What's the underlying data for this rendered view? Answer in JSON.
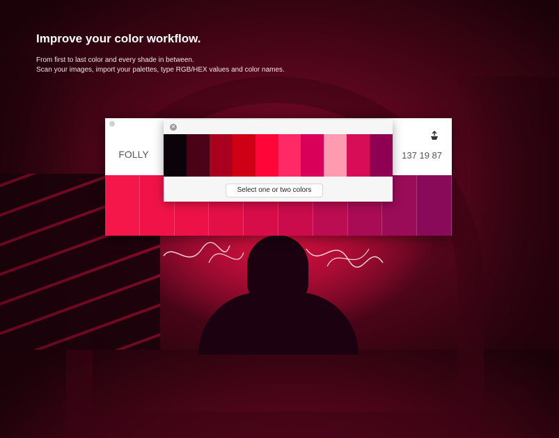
{
  "hero": {
    "title": "Improve your color workflow.",
    "line1": "From first to last color and every shade in between.",
    "line2": "Scan your images, import your palettes, type RGB/HEX values and color names."
  },
  "app": {
    "color_name": "FOLLY",
    "rgb": "137 19 87",
    "export_icon": "export-icon",
    "shades": [
      "#f5174a",
      "#f11348",
      "#ec1247",
      "#e21047",
      "#d70d4a",
      "#cb0c4c",
      "#bb0d51",
      "#a90c55",
      "#9a0c58",
      "#8a0a5a"
    ]
  },
  "picker": {
    "swatches": [
      "#0b0309",
      "#4a0216",
      "#a8001d",
      "#cf0016",
      "#ff0638",
      "#ff2966",
      "#d80058",
      "#ff9bb0",
      "#d80d57",
      "#8f0052"
    ],
    "select_label": "Select one or two colors",
    "close_icon": "close-icon"
  }
}
